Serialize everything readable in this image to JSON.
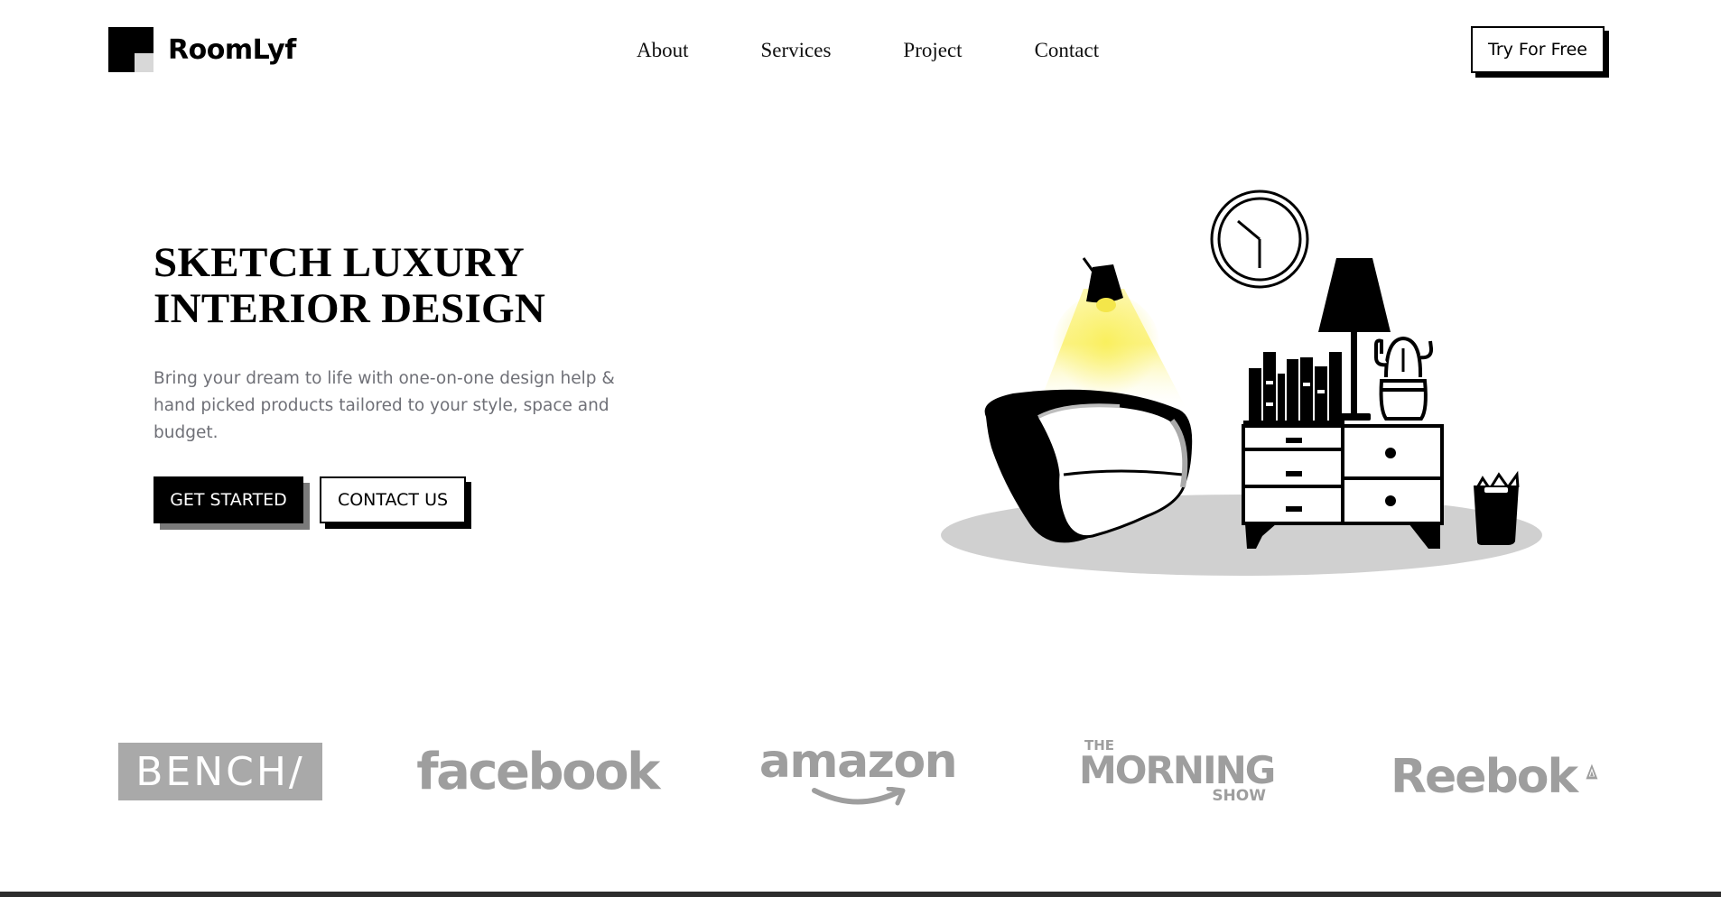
{
  "brand": {
    "name": "RoomLyf"
  },
  "nav": {
    "items": [
      {
        "label": "About"
      },
      {
        "label": "Services"
      },
      {
        "label": "Project"
      },
      {
        "label": "Contact"
      }
    ],
    "cta_label": "Try For Free"
  },
  "hero": {
    "title_line1": "SKETCH LUXURY",
    "title_line2": "INTERIOR DESIGN",
    "description": "Bring your dream to life with one-on-one design help & hand picked products tailored to your style, space and budget.",
    "primary_label": "GET STARTED",
    "secondary_label": "CONTACT US"
  },
  "partners": {
    "bench": "BENCH/",
    "facebook": "facebook",
    "amazon": "amazon",
    "morning_the": "THE",
    "morning_main": "MORNING",
    "morning_show": "SHOW",
    "reebok": "Reebok"
  },
  "colors": {
    "primary": "#000000",
    "text_muted": "#6f7077",
    "logo_accent": "#d8d8d8",
    "lamp_light": "#fbf27a",
    "floor": "#d0d0d0",
    "partner_gray": "#9e9e9e"
  }
}
